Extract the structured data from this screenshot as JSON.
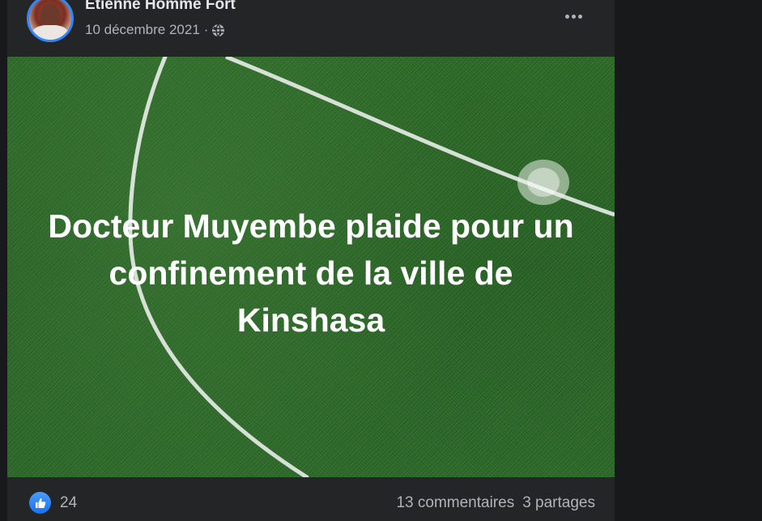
{
  "post": {
    "author": "Etienne Homme Fort",
    "date": "10 décembre 2021",
    "separator": "·",
    "privacy_icon": "globe-icon",
    "more_icon": "more-options-icon",
    "image_text": "Docteur Muyembe plaide pour un confinement de la ville de Kinshasa",
    "reactions": {
      "icon": "like-icon",
      "count": "24"
    },
    "comments": "13 commentaires",
    "shares": "3 partages"
  },
  "colors": {
    "page_bg": "#18191a",
    "card_bg": "#242526",
    "primary_text": "#e4e6eb",
    "secondary_text": "#b0b3b8",
    "accent": "#2d88ff",
    "grass": "#2f6b2a"
  }
}
